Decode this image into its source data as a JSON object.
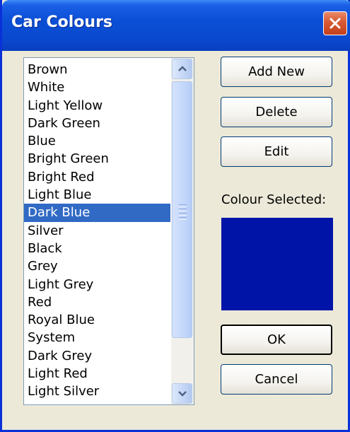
{
  "window": {
    "title": "Car Colours"
  },
  "icons": {
    "close": "close-icon",
    "scroll_up": "arrow-up-icon",
    "scroll_down": "arrow-down-icon"
  },
  "colour_list": {
    "items": [
      {
        "label": "Brown"
      },
      {
        "label": "White"
      },
      {
        "label": "Light Yellow"
      },
      {
        "label": "Dark Green"
      },
      {
        "label": "Blue"
      },
      {
        "label": "Bright Green"
      },
      {
        "label": "Bright Red"
      },
      {
        "label": "Light Blue"
      },
      {
        "label": "Dark Blue"
      },
      {
        "label": "Silver"
      },
      {
        "label": "Black"
      },
      {
        "label": "Grey"
      },
      {
        "label": "Light Grey"
      },
      {
        "label": "Red"
      },
      {
        "label": "Royal Blue"
      },
      {
        "label": "System"
      },
      {
        "label": "Dark Grey"
      },
      {
        "label": "Light Red"
      },
      {
        "label": "Light Silver"
      }
    ],
    "selected_index": 8
  },
  "buttons": {
    "add_new": "Add New",
    "delete": "Delete",
    "edit": "Edit",
    "ok": "OK",
    "cancel": "Cancel"
  },
  "colour_selected": {
    "label": "Colour Selected:",
    "colour": "#0014a8"
  }
}
